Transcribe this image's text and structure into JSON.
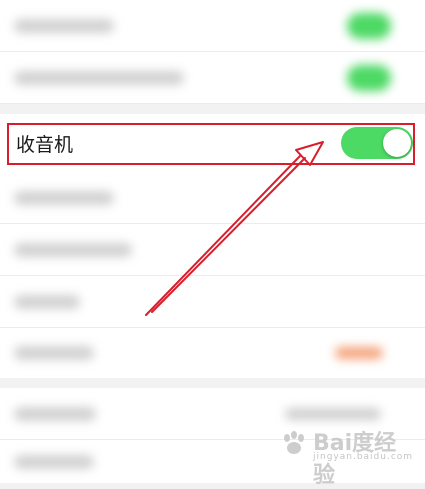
{
  "screen": {
    "radio_row": {
      "label": "收音机",
      "toggle_on": true
    },
    "colors": {
      "toggle_green": "#4cd964",
      "highlight_red": "#d81e2b",
      "orange_badge": "#f5a27a"
    },
    "watermark": {
      "brand": "Bai度经验",
      "url": "jingyan.baidu.com"
    }
  }
}
